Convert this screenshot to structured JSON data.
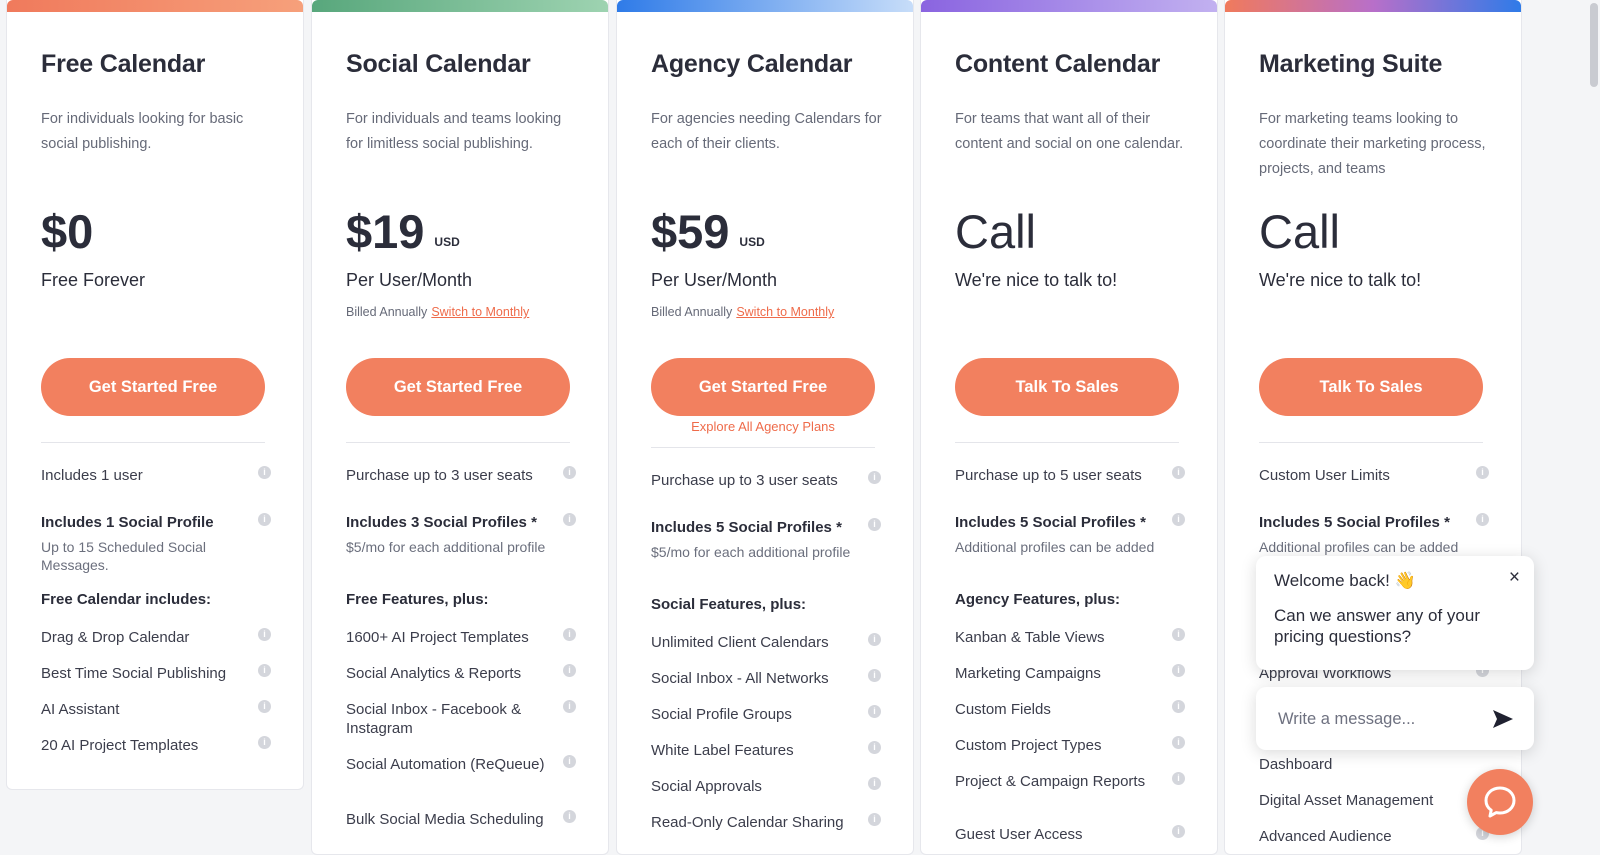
{
  "plans": [
    {
      "title": "Free Calendar",
      "description": "For individuals looking for basic social publishing.",
      "price": "$0",
      "currency": "",
      "price_note": "Free Forever",
      "billed": "",
      "switch_label": "",
      "cta": "Get Started Free",
      "explore": "",
      "bar_gradient": [
        "#f07a5c",
        "#f6a07b"
      ],
      "features": [
        {
          "title": "Includes 1 user"
        },
        {
          "title": "Includes 1 Social Profile",
          "bold": true,
          "sub": "Up to 15 Scheduled Social Messages."
        }
      ],
      "section": "Free Calendar includes:",
      "items": [
        "Drag & Drop Calendar",
        "Best Time Social Publishing",
        "AI Assistant",
        "20 AI Project Templates"
      ]
    },
    {
      "title": "Social Calendar",
      "description": "For individuals and teams looking for limitless social publishing.",
      "price": "$19",
      "currency": "USD",
      "price_note": "Per User/Month",
      "billed": "Billed Annually",
      "switch_label": "Switch to Monthly",
      "cta": "Get Started Free",
      "explore": "",
      "bar_gradient": [
        "#58a77c",
        "#9ed3b1"
      ],
      "features": [
        {
          "title": "Purchase up to 3 user seats"
        },
        {
          "title": "Includes 3 Social Profiles *",
          "bold": true,
          "sub": "$5/mo for each additional profile"
        }
      ],
      "section": "Free Features, plus:",
      "items": [
        "1600+ AI Project Templates",
        "Social Analytics & Reports",
        "Social Inbox - Facebook & Instagram",
        "Social Automation (ReQueue)",
        "Bulk Social Media Scheduling"
      ]
    },
    {
      "title": "Agency Calendar",
      "description": "For agencies needing Calendars for each of their clients.",
      "price": "$59",
      "currency": "USD",
      "price_note": "Per User/Month",
      "billed": "Billed Annually",
      "switch_label": "Switch to Monthly",
      "cta": "Get Started Free",
      "explore": "Explore All Agency Plans",
      "bar_gradient": [
        "#2f7be8",
        "#c7ddf9"
      ],
      "features": [
        {
          "title": "Purchase up to 3 user seats"
        },
        {
          "title": "Includes 5 Social Profiles *",
          "bold": true,
          "sub": "$5/mo for each additional profile"
        }
      ],
      "section": "Social Features, plus:",
      "items": [
        "Unlimited Client Calendars",
        "Social Inbox - All Networks",
        "Social Profile Groups",
        "White Label Features",
        "Social Approvals",
        "Read-Only Calendar Sharing"
      ]
    },
    {
      "title": "Content Calendar",
      "description": "For teams that want all of their content and social on one calendar.",
      "price": "Call",
      "currency": "",
      "price_note": "We're nice to talk to!",
      "billed": "",
      "switch_label": "",
      "cta": "Talk To Sales",
      "explore": "",
      "bar_gradient": [
        "#8a64e0",
        "#c2b1f0"
      ],
      "features": [
        {
          "title": "Purchase up to 5 user seats"
        },
        {
          "title": "Includes 5 Social Profiles *",
          "bold": true,
          "sub": "Additional profiles can be added"
        }
      ],
      "section": "Agency Features, plus:",
      "items": [
        "Kanban & Table Views",
        "Marketing Campaigns",
        "Custom Fields",
        "Custom Project Types",
        "Project & Campaign Reports",
        "Guest User Access"
      ]
    },
    {
      "title": "Marketing Suite",
      "description": "For marketing teams looking to coordinate their marketing process, projects, and teams",
      "price": "Call",
      "currency": "",
      "price_note": "We're nice to talk to!",
      "billed": "",
      "switch_label": "",
      "cta": "Talk To Sales",
      "explore": "",
      "bar_gradient": [
        "#f07a5c",
        "#2f7be8"
      ],
      "features": [
        {
          "title": "Custom User Limits"
        },
        {
          "title": "Includes 5 Social Profiles *",
          "bold": true,
          "sub": "Additional profiles can be added"
        }
      ],
      "section": "",
      "items": [
        "Approval Workflows",
        "Dashboard",
        "Digital Asset Management",
        "Advanced Audience"
      ]
    }
  ],
  "chat": {
    "welcome": "Welcome back! 👋",
    "question": "Can we answer any of your pricing questions?",
    "close": "×",
    "input_placeholder": "Write a message...",
    "launcher_icon": "chat-bubble-icon",
    "send_icon": "send-arrow-icon"
  },
  "colors": {
    "accent": "#f2805f",
    "link": "#ef6b4a",
    "text": "#2b2d3a",
    "muted": "#666a78"
  }
}
